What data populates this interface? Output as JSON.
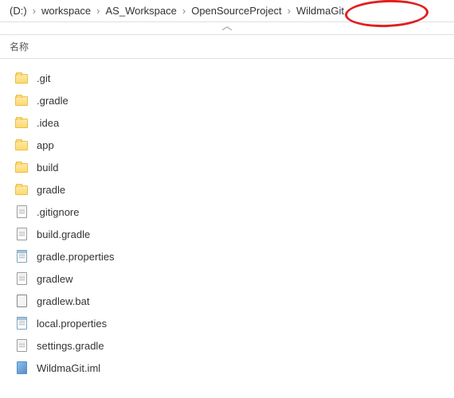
{
  "breadcrumb": {
    "items": [
      {
        "label": "(D:)"
      },
      {
        "label": "workspace"
      },
      {
        "label": "AS_Workspace"
      },
      {
        "label": "OpenSourceProject"
      },
      {
        "label": "WildmaGit"
      }
    ],
    "separator": "›"
  },
  "collapse_glyph": "︿",
  "header": {
    "name_col": "名称"
  },
  "files": [
    {
      "name": ".git",
      "icon": "folder"
    },
    {
      "name": ".gradle",
      "icon": "folder"
    },
    {
      "name": ".idea",
      "icon": "folder"
    },
    {
      "name": "app",
      "icon": "folder"
    },
    {
      "name": "build",
      "icon": "folder"
    },
    {
      "name": "gradle",
      "icon": "folder"
    },
    {
      "name": ".gitignore",
      "icon": "file"
    },
    {
      "name": "build.gradle",
      "icon": "file"
    },
    {
      "name": "gradle.properties",
      "icon": "notepad"
    },
    {
      "name": "gradlew",
      "icon": "file"
    },
    {
      "name": "gradlew.bat",
      "icon": "bat"
    },
    {
      "name": "local.properties",
      "icon": "notepad"
    },
    {
      "name": "settings.gradle",
      "icon": "file"
    },
    {
      "name": "WildmaGit.iml",
      "icon": "iml"
    }
  ]
}
